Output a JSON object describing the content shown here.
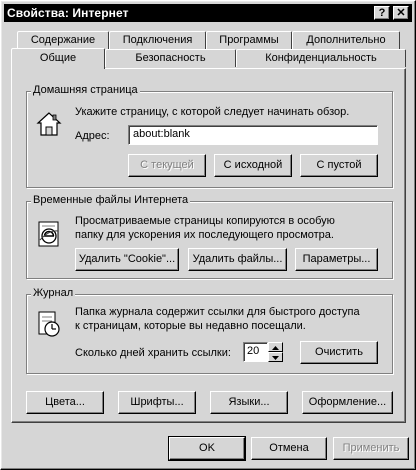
{
  "window": {
    "title": "Свойства: Интернет",
    "help_label": "?",
    "close_label": "✕"
  },
  "tabs_row1": [
    "Содержание",
    "Подключения",
    "Программы",
    "Дополнительно"
  ],
  "tabs_row2": [
    "Общие",
    "Безопасность",
    "Конфиденциальность"
  ],
  "active_tab": "Общие",
  "homepage": {
    "group_label": "Домашняя страница",
    "description": "Укажите страницу, с которой следует начинать обзор.",
    "address_label": "Адрес:",
    "address_value": "about:blank",
    "btn_current": "С текущей",
    "btn_default": "С исходной",
    "btn_blank": "С пустой"
  },
  "temp_files": {
    "group_label": "Временные файлы Интернета",
    "desc_line1": "Просматриваемые страницы копируются в особую",
    "desc_line2": "папку для ускорения их последующего просмотра.",
    "btn_cookies": "Удалить \"Cookie\"...",
    "btn_files": "Удалить файлы...",
    "btn_settings": "Параметры..."
  },
  "history": {
    "group_label": "Журнал",
    "desc_line1": "Папка журнала содержит ссылки для быстрого доступа",
    "desc_line2": "к страницам, которые вы недавно посещали.",
    "days_label": "Сколько дней хранить ссылки:",
    "days_value": "20",
    "btn_clear": "Очистить"
  },
  "bottom_buttons": {
    "colors": "Цвета...",
    "fonts": "Шрифты...",
    "languages": "Языки...",
    "accessibility": "Оформление..."
  },
  "dialog_buttons": {
    "ok": "OK",
    "cancel": "Отмена",
    "apply": "Применить"
  }
}
